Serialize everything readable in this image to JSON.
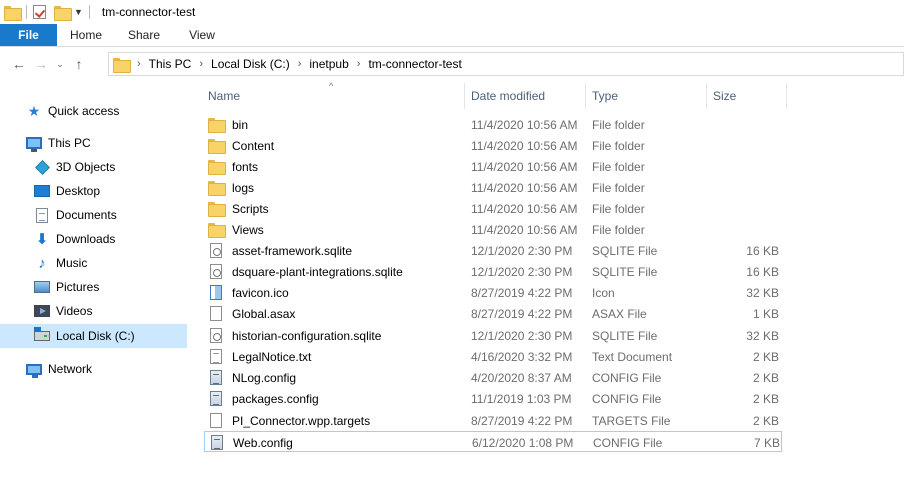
{
  "window": {
    "title": "tm-connector-test"
  },
  "ribbon": {
    "tabs": [
      "File",
      "Home",
      "Share",
      "View"
    ]
  },
  "address": {
    "crumbs": [
      "This PC",
      "Local Disk (C:)",
      "inetpub",
      "tm-connector-test"
    ]
  },
  "nav": {
    "items": [
      {
        "label": "Quick access",
        "icon": "star-icon"
      },
      {
        "label": "This PC",
        "icon": "computer-icon"
      },
      {
        "label": "3D Objects",
        "icon": "3d-objects-icon"
      },
      {
        "label": "Desktop",
        "icon": "desktop-icon"
      },
      {
        "label": "Documents",
        "icon": "documents-icon"
      },
      {
        "label": "Downloads",
        "icon": "downloads-icon"
      },
      {
        "label": "Music",
        "icon": "music-icon"
      },
      {
        "label": "Pictures",
        "icon": "pictures-icon"
      },
      {
        "label": "Videos",
        "icon": "videos-icon"
      },
      {
        "label": "Local Disk (C:)",
        "icon": "local-disk-icon"
      },
      {
        "label": "Network",
        "icon": "network-icon"
      }
    ],
    "selected": "Local Disk (C:)"
  },
  "columns": {
    "name": "Name",
    "date": "Date modified",
    "type": "Type",
    "size": "Size"
  },
  "files": [
    {
      "name": "bin",
      "date": "11/4/2020 10:56 AM",
      "type": "File folder",
      "size": "",
      "icon": "folder-icon"
    },
    {
      "name": "Content",
      "date": "11/4/2020 10:56 AM",
      "type": "File folder",
      "size": "",
      "icon": "folder-icon"
    },
    {
      "name": "fonts",
      "date": "11/4/2020 10:56 AM",
      "type": "File folder",
      "size": "",
      "icon": "folder-icon"
    },
    {
      "name": "logs",
      "date": "11/4/2020 10:56 AM",
      "type": "File folder",
      "size": "",
      "icon": "folder-icon"
    },
    {
      "name": "Scripts",
      "date": "11/4/2020 10:56 AM",
      "type": "File folder",
      "size": "",
      "icon": "folder-icon"
    },
    {
      "name": "Views",
      "date": "11/4/2020 10:56 AM",
      "type": "File folder",
      "size": "",
      "icon": "folder-icon"
    },
    {
      "name": "asset-framework.sqlite",
      "date": "12/1/2020 2:30 PM",
      "type": "SQLITE File",
      "size": "16 KB",
      "icon": "sqlite-file-icon"
    },
    {
      "name": "dsquare-plant-integrations.sqlite",
      "date": "12/1/2020 2:30 PM",
      "type": "SQLITE File",
      "size": "16 KB",
      "icon": "sqlite-file-icon"
    },
    {
      "name": "favicon.ico",
      "date": "8/27/2019 4:22 PM",
      "type": "Icon",
      "size": "32 KB",
      "icon": "ico-file-icon"
    },
    {
      "name": "Global.asax",
      "date": "8/27/2019 4:22 PM",
      "type": "ASAX File",
      "size": "1 KB",
      "icon": "file-icon"
    },
    {
      "name": "historian-configuration.sqlite",
      "date": "12/1/2020 2:30 PM",
      "type": "SQLITE File",
      "size": "32 KB",
      "icon": "sqlite-file-icon"
    },
    {
      "name": "LegalNotice.txt",
      "date": "4/16/2020 3:32 PM",
      "type": "Text Document",
      "size": "2 KB",
      "icon": "text-file-icon"
    },
    {
      "name": "NLog.config",
      "date": "4/20/2020 8:37 AM",
      "type": "CONFIG File",
      "size": "2 KB",
      "icon": "config-file-icon"
    },
    {
      "name": "packages.config",
      "date": "11/1/2019 1:03 PM",
      "type": "CONFIG File",
      "size": "2 KB",
      "icon": "config-file-icon"
    },
    {
      "name": "PI_Connector.wpp.targets",
      "date": "8/27/2019 4:22 PM",
      "type": "TARGETS File",
      "size": "2 KB",
      "icon": "file-icon"
    },
    {
      "name": "Web.config",
      "date": "6/12/2020 1:08 PM",
      "type": "CONFIG File",
      "size": "7 KB",
      "icon": "config-file-icon"
    }
  ],
  "selected_file": "Web.config"
}
